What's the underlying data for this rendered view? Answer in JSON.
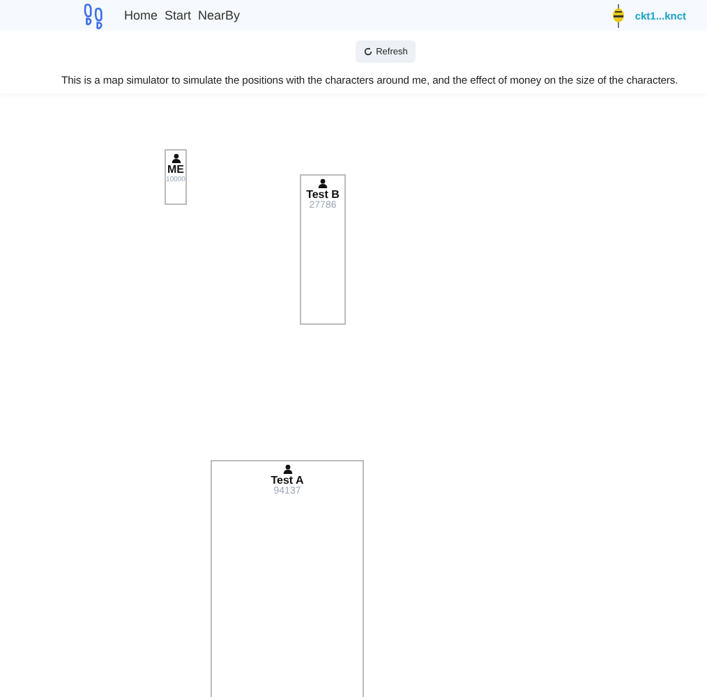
{
  "nav": {
    "links": [
      {
        "label": "Home"
      },
      {
        "label": "Start"
      },
      {
        "label": "NearBy"
      }
    ],
    "account": "ckt1...knct"
  },
  "refresh_button": "Refresh",
  "description": "This is a map simulator to simulate the positions with the characters around me, and the effect of money on the size of the characters.",
  "characters": [
    {
      "name": "ME",
      "money": "10000"
    },
    {
      "name": "Test B",
      "money": "27786"
    },
    {
      "name": "Test A",
      "money": "94137"
    }
  ]
}
